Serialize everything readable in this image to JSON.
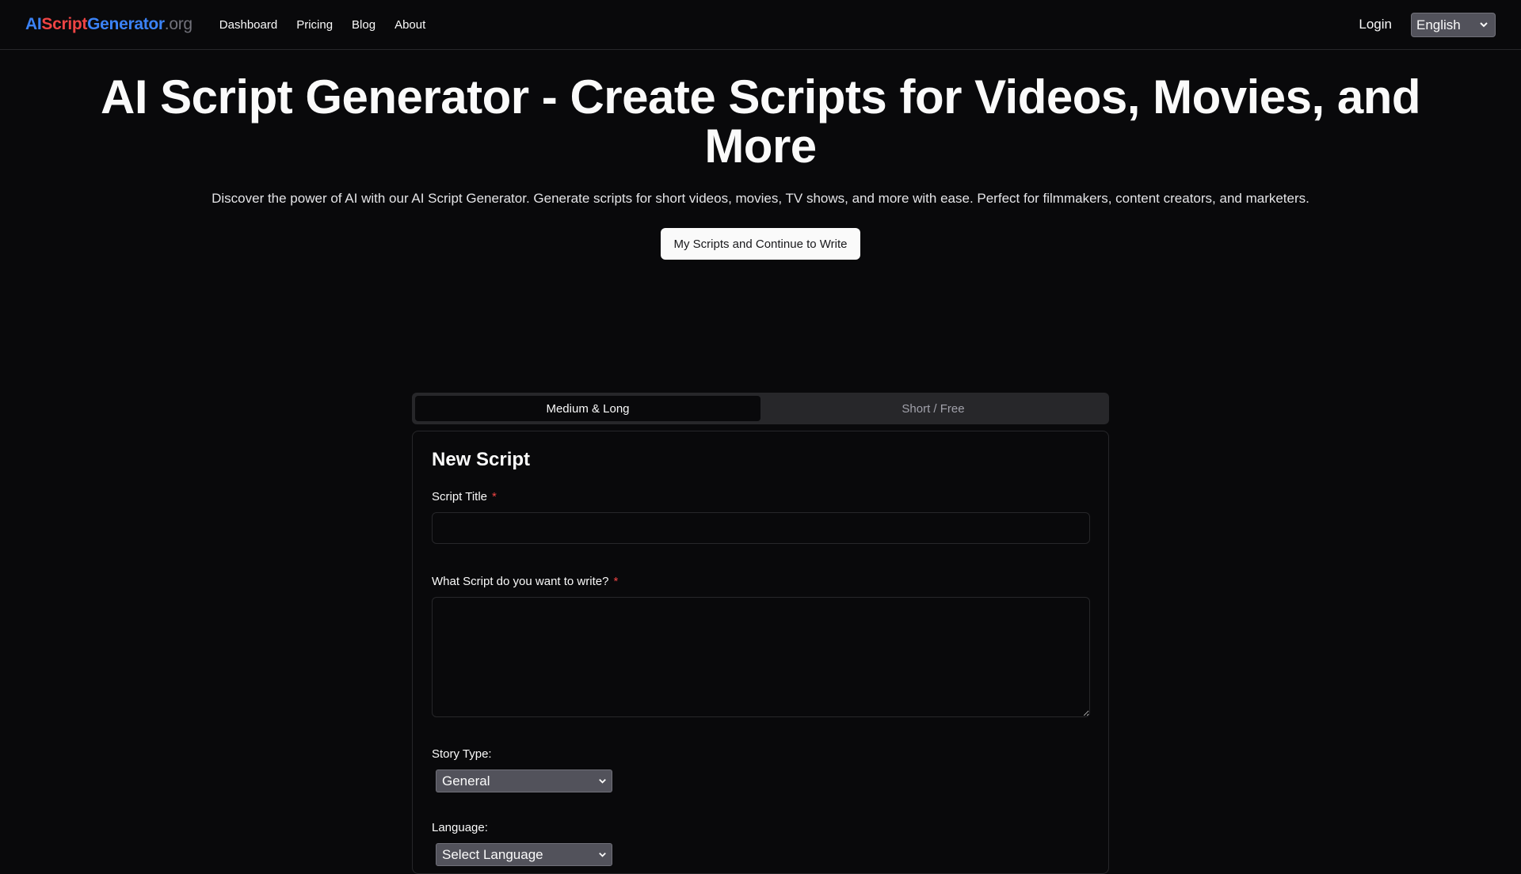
{
  "nav": {
    "logo": {
      "part1": "AI",
      "part2": "Script",
      "part3": "Generator",
      "part4": ".org"
    },
    "links": [
      "Dashboard",
      "Pricing",
      "Blog",
      "About"
    ],
    "login": "Login",
    "language": {
      "selected": "English"
    }
  },
  "hero": {
    "title": "AI Script Generator - Create Scripts for Videos, Movies, and More",
    "subtitle": "Discover the power of AI with our AI Script Generator. Generate scripts for short videos, movies, TV shows, and more with ease. Perfect for filmmakers, content creators, and marketers.",
    "button": "My Scripts and Continue to Write"
  },
  "tabs": [
    {
      "label": "Medium & Long",
      "active": true
    },
    {
      "label": "Short / Free",
      "active": false
    }
  ],
  "form": {
    "title": "New Script",
    "script_title_label": "Script Title",
    "script_title_value": "",
    "script_prompt_label": "What Script do you want to write?",
    "script_prompt_value": "",
    "required_mark": "*",
    "story_type_label": "Story Type:",
    "story_type_selected": "General",
    "language_label": "Language:",
    "language_selected": "Select Language"
  },
  "colors": {
    "background": "#09090b",
    "border": "#27272a",
    "logo_blue": "#3b82f6",
    "logo_red": "#ef4444",
    "logo_gray": "#71717a",
    "required": "#ef4444"
  },
  "icons": {
    "select_chevron": "chevron-down-icon"
  }
}
